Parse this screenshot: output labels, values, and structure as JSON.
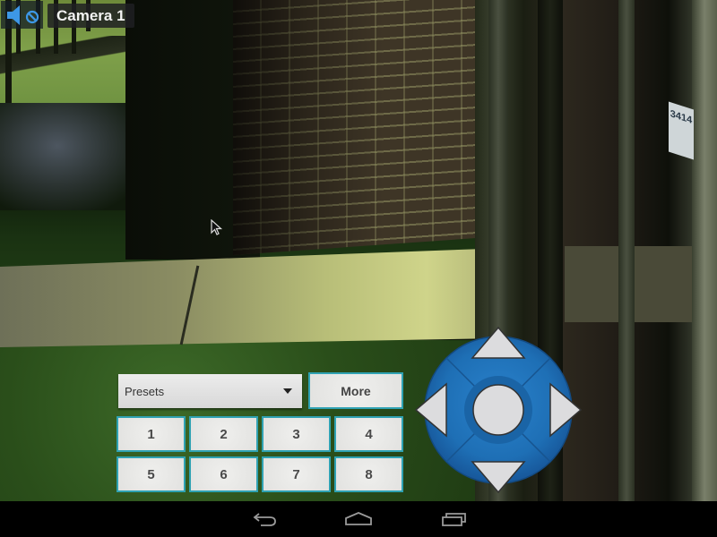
{
  "camera": {
    "title": "Camera 1",
    "audio_state": "muted",
    "audio_icon": "speaker-muted-icon",
    "building_number": "3414"
  },
  "presets": {
    "select_label": "Presets",
    "more_label": "More",
    "buttons": [
      "1",
      "2",
      "3",
      "4",
      "5",
      "6",
      "7",
      "8"
    ]
  },
  "ptz": {
    "controls": [
      "pan-up",
      "pan-down",
      "pan-left",
      "pan-right",
      "center"
    ],
    "color": "#1e6fb5"
  },
  "navbar": {
    "buttons": [
      "back",
      "home",
      "recent-apps"
    ]
  },
  "colors": {
    "button_border": "#2fa2b3",
    "button_face": "#e6e6e4",
    "audio_icon": "#3d97e6",
    "ptz_blue": "#1e6fb5"
  }
}
